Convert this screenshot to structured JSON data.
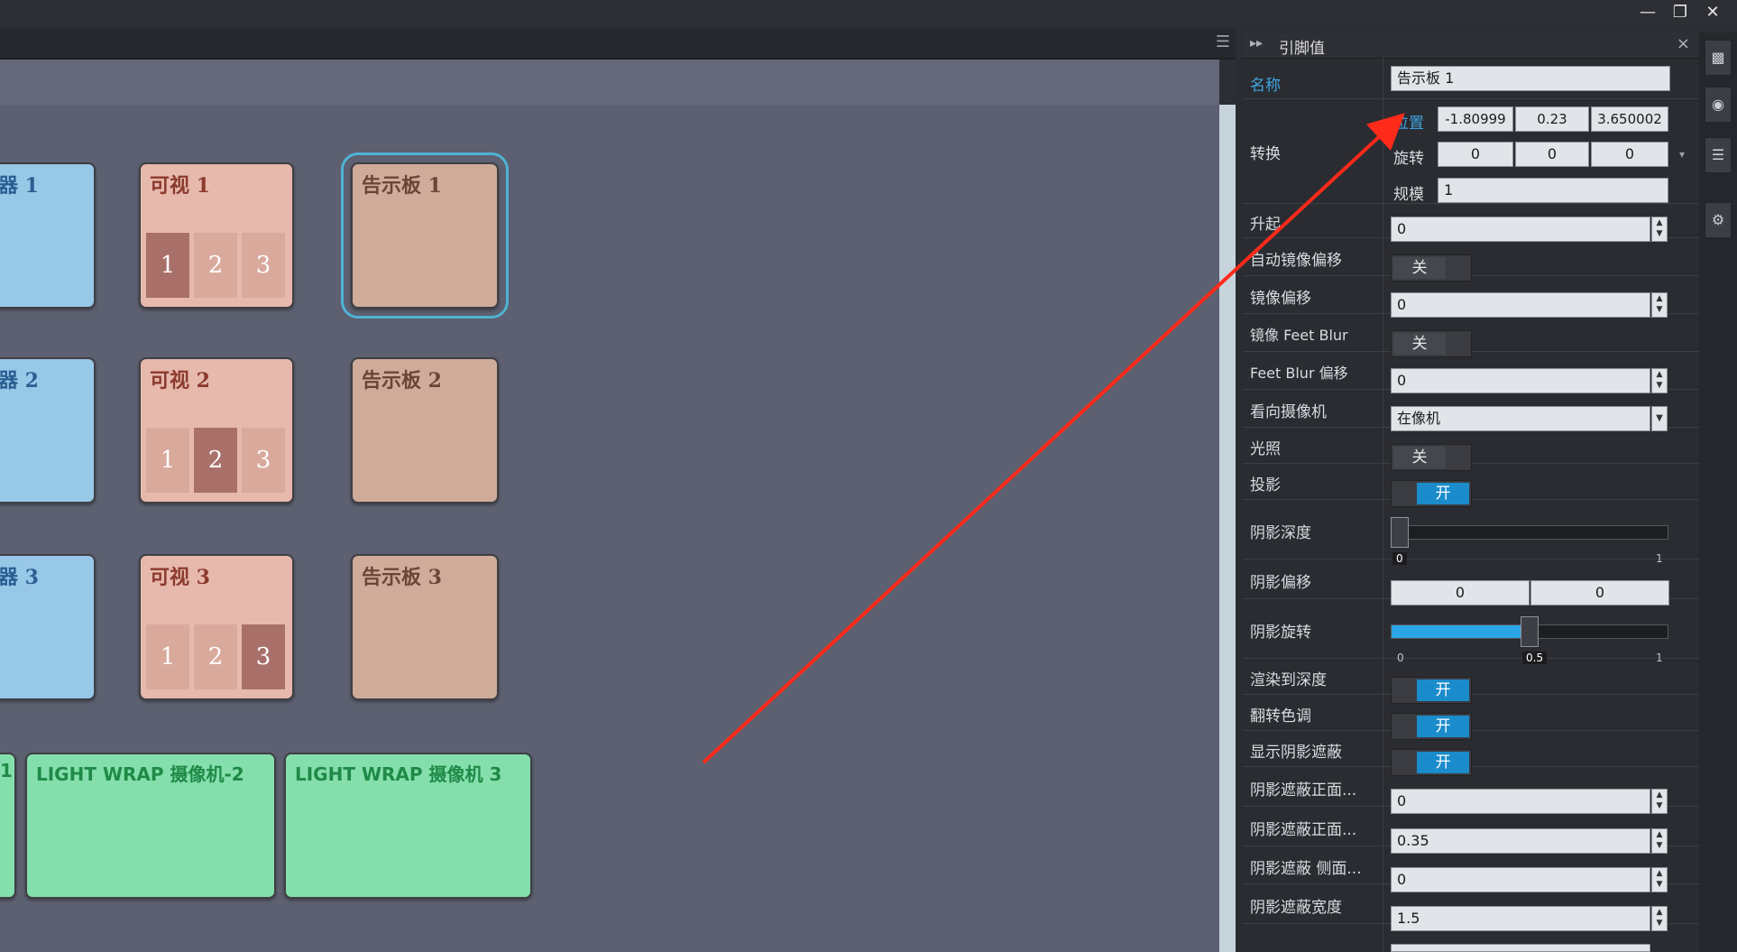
{
  "window": {
    "minimize_icon": "minimize-icon",
    "restore_icon": "restore-icon",
    "close_icon": "close-icon"
  },
  "nodes": {
    "row1": {
      "left_title": "器 1",
      "visible_title": "可视 1",
      "billboard_title": "告示板 1"
    },
    "row2": {
      "left_title": "器 2",
      "visible_title": "可视 2",
      "billboard_title": "告示板 2"
    },
    "row3": {
      "left_title": "器 3",
      "visible_title": "可视 3",
      "billboard_title": "告示板 3"
    },
    "slots": [
      "1",
      "2",
      "3"
    ],
    "green": {
      "left_partial": "1",
      "cam2": "LIGHT WRAP 摄像机-2",
      "cam3": "LIGHT WRAP 摄像机 3"
    }
  },
  "panel": {
    "title": "引脚值",
    "name": {
      "label": "名称",
      "value": "告示板 1"
    },
    "transform": {
      "label": "转换",
      "position": {
        "label": "位置",
        "x": "-1.80999",
        "y": "0.23",
        "z": "3.650002"
      },
      "rotation": {
        "label": "旋转",
        "x": "0",
        "y": "0",
        "z": "0"
      },
      "scale": {
        "label": "规模",
        "value": "1"
      }
    },
    "lift": {
      "label": "升起",
      "value": "0"
    },
    "auto_mirror_offset": {
      "label": "自动镜像偏移",
      "state": "关"
    },
    "mirror_offset": {
      "label": "镜像偏移",
      "value": "0"
    },
    "mirror_feet_blur": {
      "label": "镜像 Feet Blur",
      "state": "关"
    },
    "feet_blur_offset": {
      "label": "Feet Blur 偏移",
      "value": "0"
    },
    "look_at_camera": {
      "label": "看向摄像机",
      "value": "在像机"
    },
    "lighting": {
      "label": "光照",
      "state": "关"
    },
    "projection": {
      "label": "投影",
      "state": "开"
    },
    "shadow_depth": {
      "label": "阴影深度",
      "value": 0,
      "min": "0",
      "max": "1",
      "value_label": "0"
    },
    "shadow_offset": {
      "label": "阴影偏移",
      "x": "0",
      "y": "0"
    },
    "shadow_rotation": {
      "label": "阴影旋转",
      "value": 0.5,
      "min": "0",
      "max": "1",
      "value_label": "0.5"
    },
    "render_to_depth": {
      "label": "渲染到深度",
      "state": "开"
    },
    "invert_tone": {
      "label": "翻转色调",
      "state": "开"
    },
    "show_shadow_mask": {
      "label": "显示阴影遮蔽",
      "state": "开"
    },
    "shadow_mask_front_1": {
      "label": "阴影遮蔽正面...",
      "value": "0"
    },
    "shadow_mask_front_2": {
      "label": "阴影遮蔽正面...",
      "value": "0.35"
    },
    "shadow_mask_side": {
      "label": "阴影遮蔽 侧面...",
      "value": "0"
    },
    "shadow_mask_width": {
      "label": "阴影遮蔽宽度",
      "value": "1.5"
    }
  },
  "colors": {
    "accent": "#1b8ccb",
    "arrow": "#ff2a1a"
  }
}
